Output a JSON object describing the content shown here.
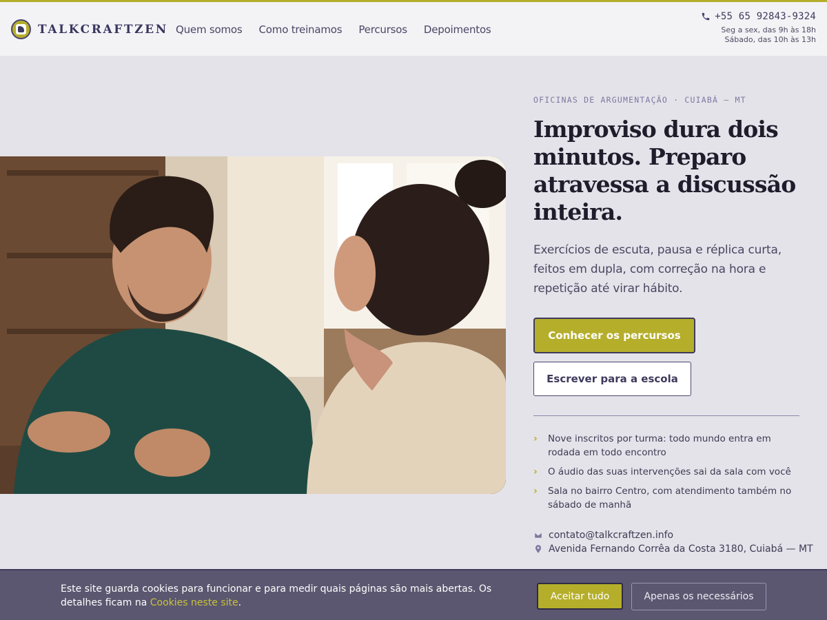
{
  "header": {
    "brand": "TALKCRAFTZEN",
    "nav": [
      "Quem somos",
      "Como treinamos",
      "Percursos",
      "Depoimentos"
    ],
    "phone": "+55 65 92843-9324",
    "hours_line1": "Seg a sex, das 9h às 18h",
    "hours_line2": "Sábado, das 10h às 13h"
  },
  "hero": {
    "eyebrow": "OFICINAS DE ARGUMENTAÇÃO · CUIABÁ — MT",
    "headline": "Improviso dura dois minutos. Preparo atravessa a discussão inteira.",
    "lead": "Exercícios de escuta, pausa e réplica curta, feitos em dupla, com correção na hora e repetição até virar hábito.",
    "primary_cta": "Conhecer os percursos",
    "secondary_cta": "Escrever para a escola",
    "features": [
      "Nove inscritos por turma: todo mundo entra em rodada em todo encontro",
      "O áudio das suas intervenções sai da sala com você",
      "Sala no bairro Centro, com atendimento também no sábado de manhã"
    ],
    "email": "contato@talkcraftzen.info",
    "address": "Avenida Fernando Corrêa da Costa 3180, Cuiabá — MT"
  },
  "cookie": {
    "text": "Este site guarda cookies para funcionar e para medir quais páginas são mais abertas. Os detalhes ficam na ",
    "link": "Cookies neste site",
    "after": ".",
    "accept": "Aceitar tudo",
    "necessary": "Apenas os necessários"
  },
  "colors": {
    "accent": "#b5ae2b",
    "brand": "#3e3a5c",
    "background": "#e4e3ea"
  }
}
